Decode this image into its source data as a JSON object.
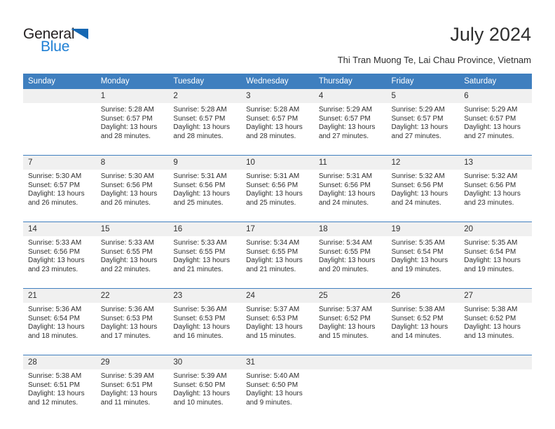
{
  "brand": {
    "name_top": "General",
    "name_bottom": "Blue",
    "accent_color": "#1668b3",
    "blue_text_color": "#1e7fd4"
  },
  "header": {
    "title": "July 2024",
    "subtitle": "Thi Tran Muong Te, Lai Chau Province, Vietnam"
  },
  "calendar": {
    "header_bg": "#3f7fbf",
    "daynum_bg": "#f0f0f0",
    "weekday_headers": [
      "Sunday",
      "Monday",
      "Tuesday",
      "Wednesday",
      "Thursday",
      "Friday",
      "Saturday"
    ],
    "weeks": [
      [
        {
          "day": "",
          "sunrise": "",
          "sunset": "",
          "daylight": ""
        },
        {
          "day": "1",
          "sunrise": "Sunrise: 5:28 AM",
          "sunset": "Sunset: 6:57 PM",
          "daylight": "Daylight: 13 hours and 28 minutes."
        },
        {
          "day": "2",
          "sunrise": "Sunrise: 5:28 AM",
          "sunset": "Sunset: 6:57 PM",
          "daylight": "Daylight: 13 hours and 28 minutes."
        },
        {
          "day": "3",
          "sunrise": "Sunrise: 5:28 AM",
          "sunset": "Sunset: 6:57 PM",
          "daylight": "Daylight: 13 hours and 28 minutes."
        },
        {
          "day": "4",
          "sunrise": "Sunrise: 5:29 AM",
          "sunset": "Sunset: 6:57 PM",
          "daylight": "Daylight: 13 hours and 27 minutes."
        },
        {
          "day": "5",
          "sunrise": "Sunrise: 5:29 AM",
          "sunset": "Sunset: 6:57 PM",
          "daylight": "Daylight: 13 hours and 27 minutes."
        },
        {
          "day": "6",
          "sunrise": "Sunrise: 5:29 AM",
          "sunset": "Sunset: 6:57 PM",
          "daylight": "Daylight: 13 hours and 27 minutes."
        }
      ],
      [
        {
          "day": "7",
          "sunrise": "Sunrise: 5:30 AM",
          "sunset": "Sunset: 6:57 PM",
          "daylight": "Daylight: 13 hours and 26 minutes."
        },
        {
          "day": "8",
          "sunrise": "Sunrise: 5:30 AM",
          "sunset": "Sunset: 6:56 PM",
          "daylight": "Daylight: 13 hours and 26 minutes."
        },
        {
          "day": "9",
          "sunrise": "Sunrise: 5:31 AM",
          "sunset": "Sunset: 6:56 PM",
          "daylight": "Daylight: 13 hours and 25 minutes."
        },
        {
          "day": "10",
          "sunrise": "Sunrise: 5:31 AM",
          "sunset": "Sunset: 6:56 PM",
          "daylight": "Daylight: 13 hours and 25 minutes."
        },
        {
          "day": "11",
          "sunrise": "Sunrise: 5:31 AM",
          "sunset": "Sunset: 6:56 PM",
          "daylight": "Daylight: 13 hours and 24 minutes."
        },
        {
          "day": "12",
          "sunrise": "Sunrise: 5:32 AM",
          "sunset": "Sunset: 6:56 PM",
          "daylight": "Daylight: 13 hours and 24 minutes."
        },
        {
          "day": "13",
          "sunrise": "Sunrise: 5:32 AM",
          "sunset": "Sunset: 6:56 PM",
          "daylight": "Daylight: 13 hours and 23 minutes."
        }
      ],
      [
        {
          "day": "14",
          "sunrise": "Sunrise: 5:33 AM",
          "sunset": "Sunset: 6:56 PM",
          "daylight": "Daylight: 13 hours and 23 minutes."
        },
        {
          "day": "15",
          "sunrise": "Sunrise: 5:33 AM",
          "sunset": "Sunset: 6:55 PM",
          "daylight": "Daylight: 13 hours and 22 minutes."
        },
        {
          "day": "16",
          "sunrise": "Sunrise: 5:33 AM",
          "sunset": "Sunset: 6:55 PM",
          "daylight": "Daylight: 13 hours and 21 minutes."
        },
        {
          "day": "17",
          "sunrise": "Sunrise: 5:34 AM",
          "sunset": "Sunset: 6:55 PM",
          "daylight": "Daylight: 13 hours and 21 minutes."
        },
        {
          "day": "18",
          "sunrise": "Sunrise: 5:34 AM",
          "sunset": "Sunset: 6:55 PM",
          "daylight": "Daylight: 13 hours and 20 minutes."
        },
        {
          "day": "19",
          "sunrise": "Sunrise: 5:35 AM",
          "sunset": "Sunset: 6:54 PM",
          "daylight": "Daylight: 13 hours and 19 minutes."
        },
        {
          "day": "20",
          "sunrise": "Sunrise: 5:35 AM",
          "sunset": "Sunset: 6:54 PM",
          "daylight": "Daylight: 13 hours and 19 minutes."
        }
      ],
      [
        {
          "day": "21",
          "sunrise": "Sunrise: 5:36 AM",
          "sunset": "Sunset: 6:54 PM",
          "daylight": "Daylight: 13 hours and 18 minutes."
        },
        {
          "day": "22",
          "sunrise": "Sunrise: 5:36 AM",
          "sunset": "Sunset: 6:53 PM",
          "daylight": "Daylight: 13 hours and 17 minutes."
        },
        {
          "day": "23",
          "sunrise": "Sunrise: 5:36 AM",
          "sunset": "Sunset: 6:53 PM",
          "daylight": "Daylight: 13 hours and 16 minutes."
        },
        {
          "day": "24",
          "sunrise": "Sunrise: 5:37 AM",
          "sunset": "Sunset: 6:53 PM",
          "daylight": "Daylight: 13 hours and 15 minutes."
        },
        {
          "day": "25",
          "sunrise": "Sunrise: 5:37 AM",
          "sunset": "Sunset: 6:52 PM",
          "daylight": "Daylight: 13 hours and 15 minutes."
        },
        {
          "day": "26",
          "sunrise": "Sunrise: 5:38 AM",
          "sunset": "Sunset: 6:52 PM",
          "daylight": "Daylight: 13 hours and 14 minutes."
        },
        {
          "day": "27",
          "sunrise": "Sunrise: 5:38 AM",
          "sunset": "Sunset: 6:52 PM",
          "daylight": "Daylight: 13 hours and 13 minutes."
        }
      ],
      [
        {
          "day": "28",
          "sunrise": "Sunrise: 5:38 AM",
          "sunset": "Sunset: 6:51 PM",
          "daylight": "Daylight: 13 hours and 12 minutes."
        },
        {
          "day": "29",
          "sunrise": "Sunrise: 5:39 AM",
          "sunset": "Sunset: 6:51 PM",
          "daylight": "Daylight: 13 hours and 11 minutes."
        },
        {
          "day": "30",
          "sunrise": "Sunrise: 5:39 AM",
          "sunset": "Sunset: 6:50 PM",
          "daylight": "Daylight: 13 hours and 10 minutes."
        },
        {
          "day": "31",
          "sunrise": "Sunrise: 5:40 AM",
          "sunset": "Sunset: 6:50 PM",
          "daylight": "Daylight: 13 hours and 9 minutes."
        },
        {
          "day": "",
          "sunrise": "",
          "sunset": "",
          "daylight": ""
        },
        {
          "day": "",
          "sunrise": "",
          "sunset": "",
          "daylight": ""
        },
        {
          "day": "",
          "sunrise": "",
          "sunset": "",
          "daylight": ""
        }
      ]
    ]
  }
}
